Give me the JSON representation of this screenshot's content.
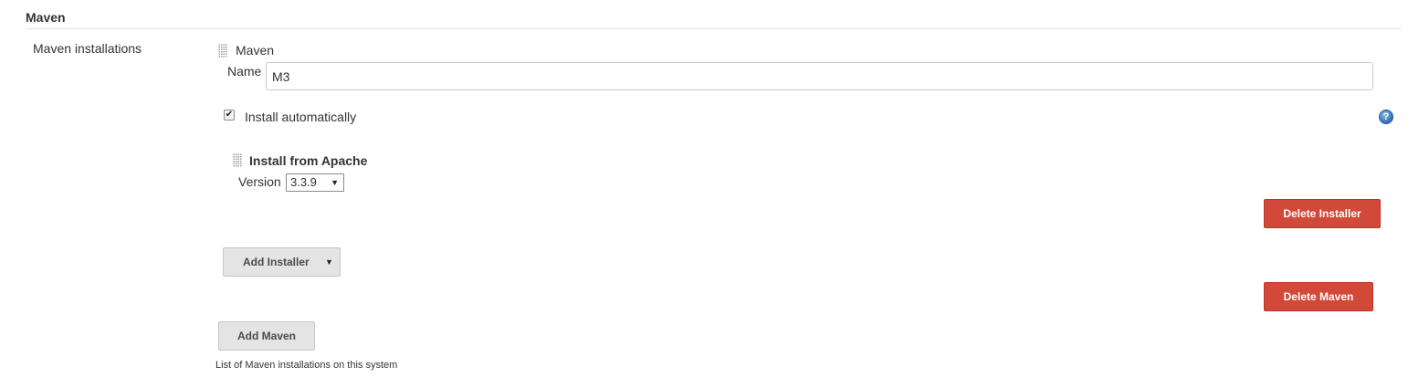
{
  "section": {
    "title": "Maven",
    "setting_name": "Maven installations",
    "description": "List of Maven installations on this system"
  },
  "installation": {
    "header": "Maven",
    "name_label": "Name",
    "name_value": "M3",
    "install_automatically": {
      "label": "Install automatically",
      "checked": true
    },
    "help_icon": "help-icon",
    "installer": {
      "title": "Install from Apache",
      "version_label": "Version",
      "version_selected": "3.3.9"
    },
    "delete_installer_label": "Delete Installer",
    "add_installer_label": "Add Installer",
    "delete_maven_label": "Delete Maven"
  },
  "add_maven_label": "Add Maven",
  "colors": {
    "danger": "#d24939",
    "button_grey": "#e4e4e4",
    "help_blue": "#2f6fb8"
  }
}
